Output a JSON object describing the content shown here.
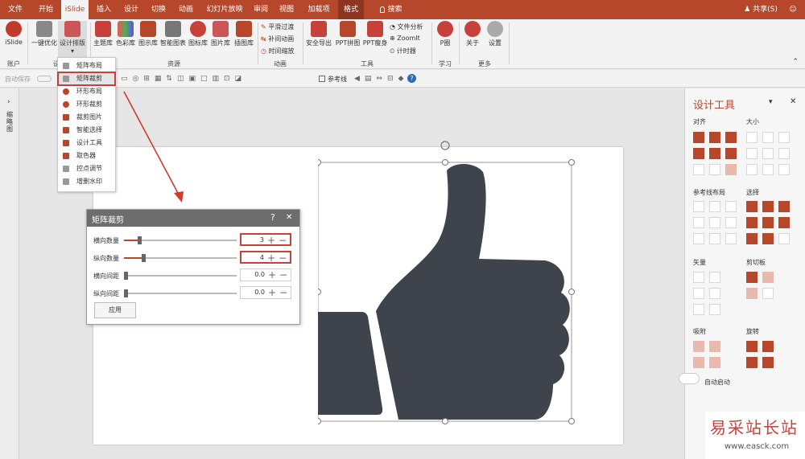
{
  "tabs": [
    "文件",
    "开始",
    "iSlide",
    "插入",
    "设计",
    "切换",
    "动画",
    "幻灯片放映",
    "审阅",
    "视图",
    "加载项",
    "格式"
  ],
  "search_label": "搜索",
  "share_label": "共享(S)",
  "ribbon": {
    "islide_label": "iSlide",
    "account_group": "账户",
    "onekey_label": "一键优化",
    "design_label": "设计排版",
    "design_group": "设",
    "theme_label": "主题库",
    "color_label": "色彩库",
    "diagram_label": "图示库",
    "chart_label": "智能图表",
    "icon_label": "图标库",
    "image_label": "图片库",
    "illus_label": "插图库",
    "resource_group": "资源",
    "anim_items": [
      "平滑过渡",
      "补间动画",
      "时间缩放"
    ],
    "anim_group": "动画",
    "export_label": "安全导出",
    "ppt_stitch_label": "PPT拼图",
    "ppt_slim_label": "PPT瘦身",
    "tool_items": [
      "文件分析",
      "ZoomIt",
      "计时器"
    ],
    "tool_group": "工具",
    "pcircle_label": "P圈",
    "learn_group": "学习",
    "about_label": "关于",
    "settings_label": "设置",
    "more_group": "更多"
  },
  "qat": {
    "autosave": "自动保存",
    "guide": "参考线"
  },
  "left_panel": {
    "label": "缩略图"
  },
  "menu": {
    "items": [
      "矩阵布局",
      "矩阵裁剪",
      "环形布局",
      "环形裁剪",
      "裁剪图片",
      "智能选择",
      "设计工具",
      "取色器",
      "控点调节",
      "增删水印"
    ],
    "active": 1
  },
  "dialog": {
    "title": "矩阵裁剪",
    "help": "?",
    "close": "✕",
    "rows": [
      {
        "label": "横向数量",
        "value": "3",
        "level": 0.12
      },
      {
        "label": "纵向数量",
        "value": "4",
        "level": 0.16
      },
      {
        "label": "横向间距",
        "value": "0.0",
        "level": 0
      },
      {
        "label": "纵向间距",
        "value": "0.0",
        "level": 0
      }
    ],
    "apply": "应用"
  },
  "right_panel": {
    "title": "设计工具",
    "align": "对齐",
    "size": "大小",
    "guide_layout": "参考线布局",
    "select": "选择",
    "vector": "矢量",
    "clip": "剪切板",
    "snap": "吸附",
    "rotate": "旋转",
    "auto_start": "自动启动"
  },
  "watermark": {
    "text": "易采站长站",
    "url": "www.easck.com"
  },
  "colors": {
    "accent": "#b7472a",
    "thumb": "#3f434c"
  }
}
